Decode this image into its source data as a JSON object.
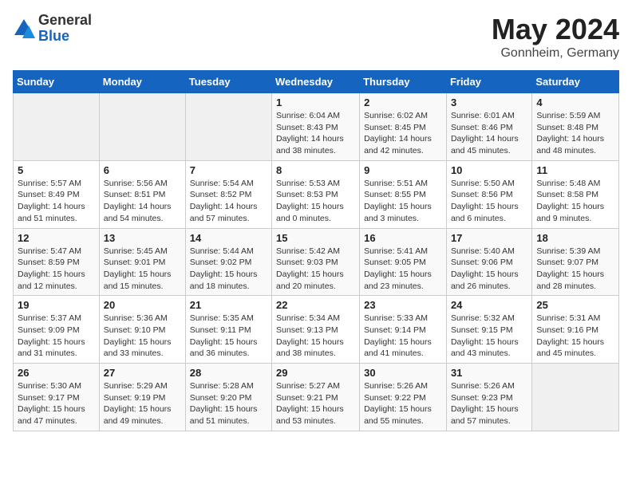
{
  "header": {
    "logo_general": "General",
    "logo_blue": "Blue",
    "month_title": "May 2024",
    "location": "Gonnheim, Germany"
  },
  "calendar": {
    "weekdays": [
      "Sunday",
      "Monday",
      "Tuesday",
      "Wednesday",
      "Thursday",
      "Friday",
      "Saturday"
    ],
    "weeks": [
      [
        {
          "day": "",
          "info": ""
        },
        {
          "day": "",
          "info": ""
        },
        {
          "day": "",
          "info": ""
        },
        {
          "day": "1",
          "info": "Sunrise: 6:04 AM\nSunset: 8:43 PM\nDaylight: 14 hours\nand 38 minutes."
        },
        {
          "day": "2",
          "info": "Sunrise: 6:02 AM\nSunset: 8:45 PM\nDaylight: 14 hours\nand 42 minutes."
        },
        {
          "day": "3",
          "info": "Sunrise: 6:01 AM\nSunset: 8:46 PM\nDaylight: 14 hours\nand 45 minutes."
        },
        {
          "day": "4",
          "info": "Sunrise: 5:59 AM\nSunset: 8:48 PM\nDaylight: 14 hours\nand 48 minutes."
        }
      ],
      [
        {
          "day": "5",
          "info": "Sunrise: 5:57 AM\nSunset: 8:49 PM\nDaylight: 14 hours\nand 51 minutes."
        },
        {
          "day": "6",
          "info": "Sunrise: 5:56 AM\nSunset: 8:51 PM\nDaylight: 14 hours\nand 54 minutes."
        },
        {
          "day": "7",
          "info": "Sunrise: 5:54 AM\nSunset: 8:52 PM\nDaylight: 14 hours\nand 57 minutes."
        },
        {
          "day": "8",
          "info": "Sunrise: 5:53 AM\nSunset: 8:53 PM\nDaylight: 15 hours\nand 0 minutes."
        },
        {
          "day": "9",
          "info": "Sunrise: 5:51 AM\nSunset: 8:55 PM\nDaylight: 15 hours\nand 3 minutes."
        },
        {
          "day": "10",
          "info": "Sunrise: 5:50 AM\nSunset: 8:56 PM\nDaylight: 15 hours\nand 6 minutes."
        },
        {
          "day": "11",
          "info": "Sunrise: 5:48 AM\nSunset: 8:58 PM\nDaylight: 15 hours\nand 9 minutes."
        }
      ],
      [
        {
          "day": "12",
          "info": "Sunrise: 5:47 AM\nSunset: 8:59 PM\nDaylight: 15 hours\nand 12 minutes."
        },
        {
          "day": "13",
          "info": "Sunrise: 5:45 AM\nSunset: 9:01 PM\nDaylight: 15 hours\nand 15 minutes."
        },
        {
          "day": "14",
          "info": "Sunrise: 5:44 AM\nSunset: 9:02 PM\nDaylight: 15 hours\nand 18 minutes."
        },
        {
          "day": "15",
          "info": "Sunrise: 5:42 AM\nSunset: 9:03 PM\nDaylight: 15 hours\nand 20 minutes."
        },
        {
          "day": "16",
          "info": "Sunrise: 5:41 AM\nSunset: 9:05 PM\nDaylight: 15 hours\nand 23 minutes."
        },
        {
          "day": "17",
          "info": "Sunrise: 5:40 AM\nSunset: 9:06 PM\nDaylight: 15 hours\nand 26 minutes."
        },
        {
          "day": "18",
          "info": "Sunrise: 5:39 AM\nSunset: 9:07 PM\nDaylight: 15 hours\nand 28 minutes."
        }
      ],
      [
        {
          "day": "19",
          "info": "Sunrise: 5:37 AM\nSunset: 9:09 PM\nDaylight: 15 hours\nand 31 minutes."
        },
        {
          "day": "20",
          "info": "Sunrise: 5:36 AM\nSunset: 9:10 PM\nDaylight: 15 hours\nand 33 minutes."
        },
        {
          "day": "21",
          "info": "Sunrise: 5:35 AM\nSunset: 9:11 PM\nDaylight: 15 hours\nand 36 minutes."
        },
        {
          "day": "22",
          "info": "Sunrise: 5:34 AM\nSunset: 9:13 PM\nDaylight: 15 hours\nand 38 minutes."
        },
        {
          "day": "23",
          "info": "Sunrise: 5:33 AM\nSunset: 9:14 PM\nDaylight: 15 hours\nand 41 minutes."
        },
        {
          "day": "24",
          "info": "Sunrise: 5:32 AM\nSunset: 9:15 PM\nDaylight: 15 hours\nand 43 minutes."
        },
        {
          "day": "25",
          "info": "Sunrise: 5:31 AM\nSunset: 9:16 PM\nDaylight: 15 hours\nand 45 minutes."
        }
      ],
      [
        {
          "day": "26",
          "info": "Sunrise: 5:30 AM\nSunset: 9:17 PM\nDaylight: 15 hours\nand 47 minutes."
        },
        {
          "day": "27",
          "info": "Sunrise: 5:29 AM\nSunset: 9:19 PM\nDaylight: 15 hours\nand 49 minutes."
        },
        {
          "day": "28",
          "info": "Sunrise: 5:28 AM\nSunset: 9:20 PM\nDaylight: 15 hours\nand 51 minutes."
        },
        {
          "day": "29",
          "info": "Sunrise: 5:27 AM\nSunset: 9:21 PM\nDaylight: 15 hours\nand 53 minutes."
        },
        {
          "day": "30",
          "info": "Sunrise: 5:26 AM\nSunset: 9:22 PM\nDaylight: 15 hours\nand 55 minutes."
        },
        {
          "day": "31",
          "info": "Sunrise: 5:26 AM\nSunset: 9:23 PM\nDaylight: 15 hours\nand 57 minutes."
        },
        {
          "day": "",
          "info": ""
        }
      ]
    ]
  }
}
